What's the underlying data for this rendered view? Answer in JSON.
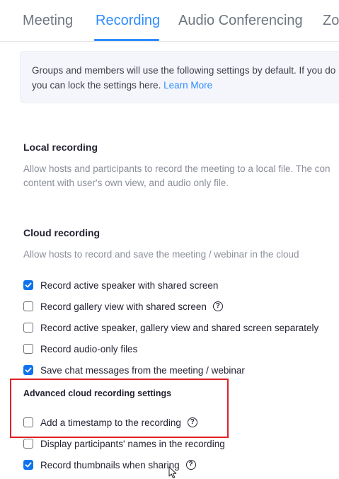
{
  "tabs": [
    {
      "label": "Meeting",
      "active": false
    },
    {
      "label": "Recording",
      "active": true
    },
    {
      "label": "Audio Conferencing",
      "active": false
    },
    {
      "label": "Zo",
      "active": false
    }
  ],
  "banner": {
    "line1": "Groups and members will use the following settings by default. If you do",
    "line2": "you can lock the settings here.",
    "link": "Learn More"
  },
  "local_recording": {
    "title": "Local recording",
    "desc_line1": "Allow hosts and participants to record the meeting to a local file. The con",
    "desc_line2": "content with user's own view, and audio only file."
  },
  "cloud_recording": {
    "title": "Cloud recording",
    "desc": "Allow hosts to record and save the meeting / webinar in the cloud",
    "options": [
      {
        "label": "Record active speaker with shared screen",
        "checked": true,
        "help": false
      },
      {
        "label": "Record gallery view with shared screen",
        "checked": false,
        "help": true
      },
      {
        "label": "Record active speaker, gallery view and shared screen separately",
        "checked": false,
        "help": false
      },
      {
        "label": "Record audio-only files",
        "checked": false,
        "help": false
      },
      {
        "label": "Save chat messages from the meeting / webinar",
        "checked": true,
        "help": false
      }
    ]
  },
  "advanced": {
    "title": "Advanced cloud recording settings",
    "options": [
      {
        "label": "Add a timestamp to the recording",
        "checked": false,
        "help": true
      },
      {
        "label": "Display participants' names in the recording",
        "checked": false,
        "help": false
      },
      {
        "label": "Record thumbnails when sharing",
        "checked": true,
        "help": true
      }
    ]
  },
  "help_glyph": "?",
  "colors": {
    "accent": "#2d8cff",
    "checkbox_checked": "#0e72ed",
    "highlight": "#e02126"
  },
  "icons": {
    "check": "check-icon",
    "help": "question-circle-icon",
    "cursor": "mouse-cursor-icon"
  }
}
